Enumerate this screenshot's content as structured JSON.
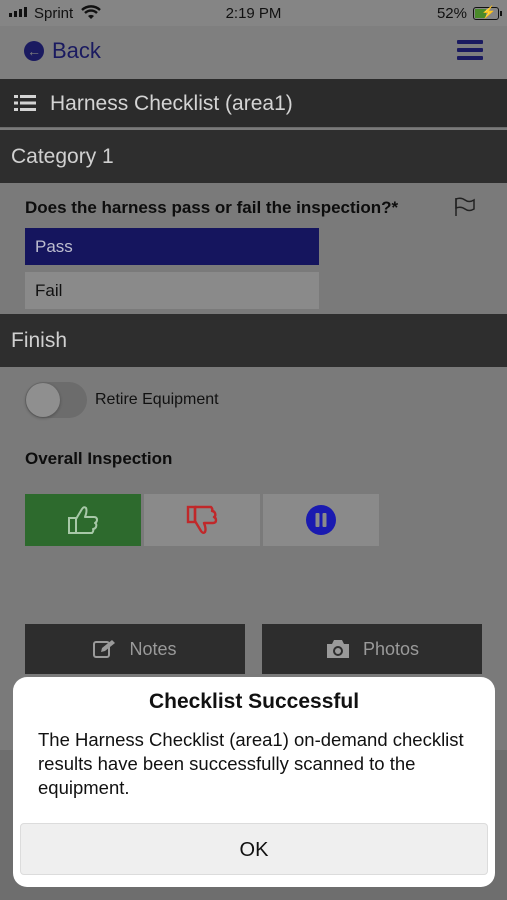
{
  "status_bar": {
    "carrier": "Sprint",
    "time": "2:19 PM",
    "battery": "52%",
    "battery_level": 0.52,
    "icons": [
      "signal-bars-icon",
      "wifi-icon",
      "battery-charging-icon"
    ]
  },
  "nav": {
    "back_label": "Back",
    "back_icon": "arrow-left-circle-icon",
    "menu_icon": "hamburger-menu-icon"
  },
  "header": {
    "title": "Harness Checklist (area1)",
    "icon": "list-icon"
  },
  "category": {
    "title": "Category 1",
    "question": "Does the harness pass or fail the inspection?*",
    "flag_icon": "flag-icon",
    "options": [
      {
        "label": "Pass",
        "selected": true
      },
      {
        "label": "Fail",
        "selected": false
      }
    ]
  },
  "finish": {
    "title": "Finish",
    "retire_label": "Retire Equipment",
    "retire_on": false,
    "overall_label": "Overall Inspection",
    "ratings": [
      {
        "icon": "thumbs-up-icon",
        "selected": true
      },
      {
        "icon": "thumbs-down-icon",
        "selected": false
      },
      {
        "icon": "pause-icon",
        "selected": false
      }
    ],
    "notes_label": "Notes",
    "notes_icon": "edit-icon",
    "photos_label": "Photos",
    "photos_icon": "camera-icon"
  },
  "alert": {
    "title": "Checklist Successful",
    "message": "The Harness Checklist (area1) on-demand checklist results have been successfully scanned to the equipment.",
    "ok_label": "OK"
  },
  "colors": {
    "accent": "#15155e",
    "pass_green": "#2d6a2d",
    "fail_red": "#c0282a",
    "pause_blue": "#1a1ab0"
  }
}
